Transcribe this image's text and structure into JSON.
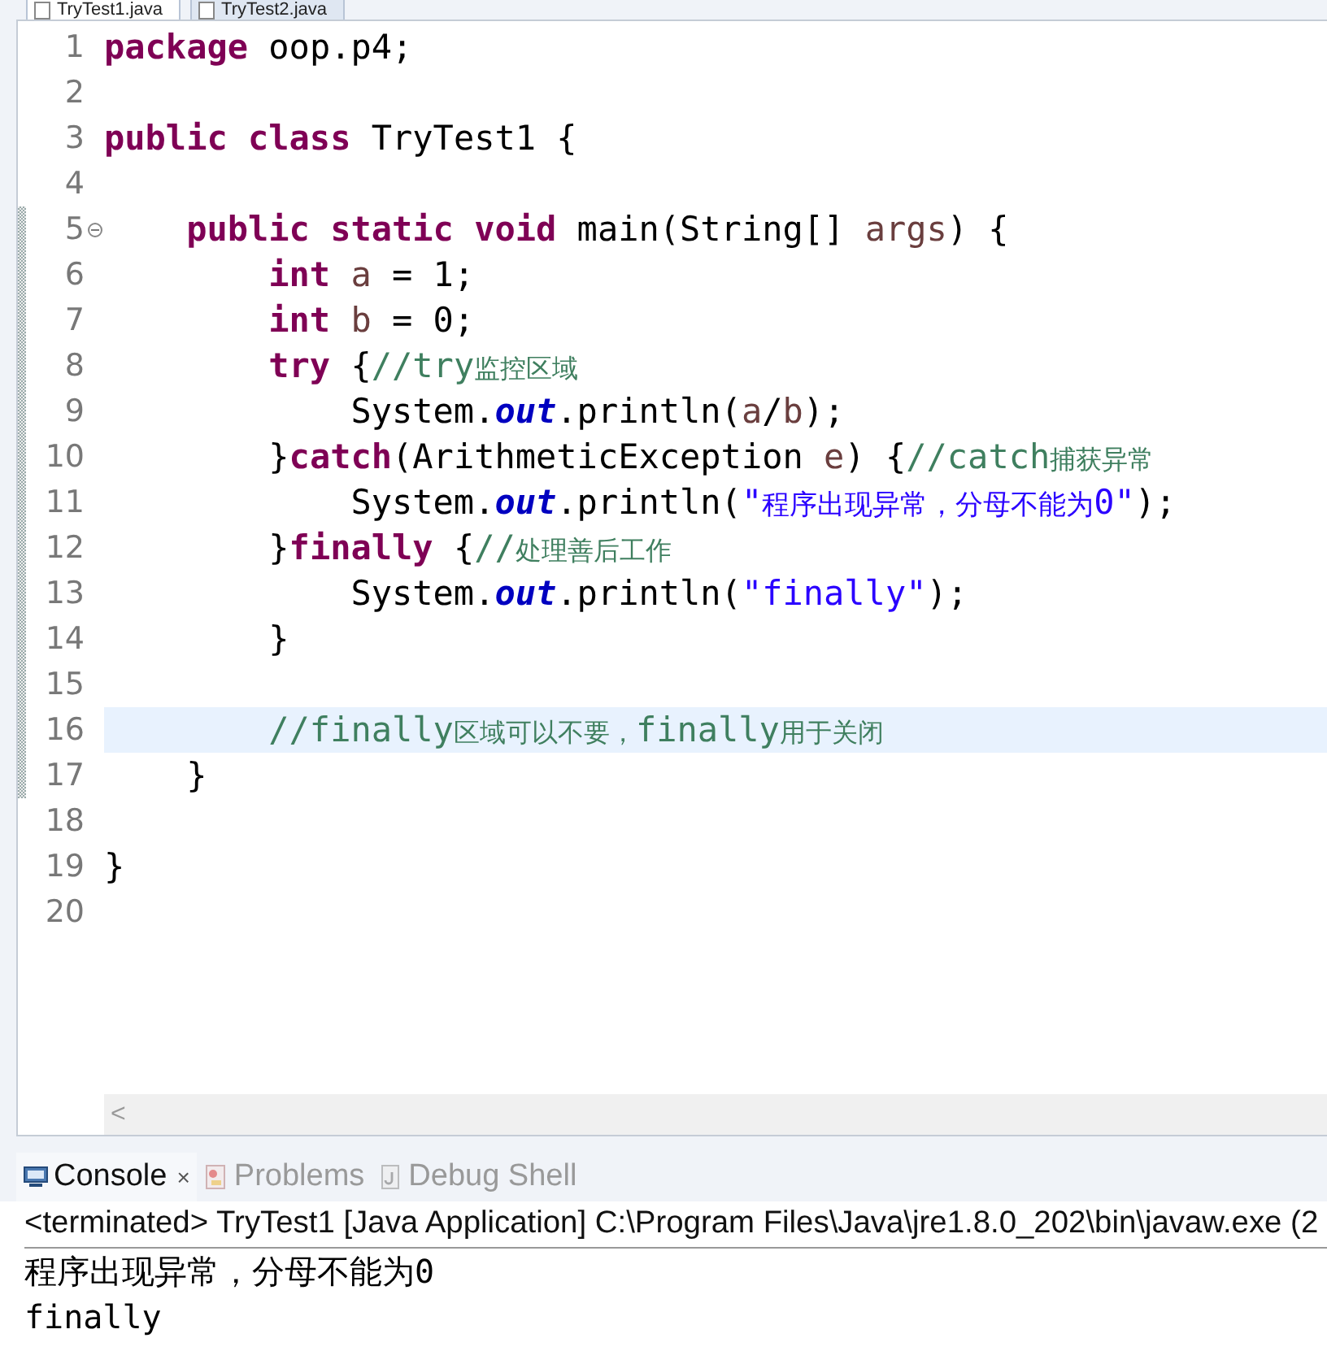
{
  "editor_tabs": [
    {
      "label": "TryTest1.java",
      "selected": true
    },
    {
      "label": "TryTest2.java",
      "selected": false
    }
  ],
  "code_lines": [
    {
      "number": "1",
      "fold": false,
      "changed": false,
      "current": false,
      "tokens": [
        {
          "kind": "keyword",
          "text": "package "
        },
        {
          "kind": "plain",
          "text": "oop.p4;"
        }
      ]
    },
    {
      "number": "2",
      "fold": false,
      "changed": false,
      "current": false
    },
    {
      "number": "3",
      "fold": false,
      "changed": false,
      "current": false,
      "tokens": [
        {
          "kind": "keyword",
          "text": "public class "
        },
        {
          "kind": "plain",
          "text": "TryTest1 {"
        }
      ]
    },
    {
      "number": "4",
      "fold": false,
      "changed": false,
      "current": false
    },
    {
      "number": "5",
      "fold": true,
      "changed": true,
      "current": false,
      "tokens": [
        {
          "kind": "keyword",
          "text": "    public static void "
        },
        {
          "kind": "plain",
          "text": "main(String[] "
        },
        {
          "kind": "local",
          "text": "args"
        },
        {
          "kind": "plain",
          "text": ") {"
        }
      ]
    },
    {
      "number": "6",
      "fold": false,
      "changed": true,
      "current": false,
      "tokens": [
        {
          "kind": "keyword",
          "text": "        int "
        },
        {
          "kind": "local",
          "text": "a"
        },
        {
          "kind": "plain",
          "text": " = 1;"
        }
      ]
    },
    {
      "number": "7",
      "fold": false,
      "changed": true,
      "current": false,
      "tokens": [
        {
          "kind": "keyword",
          "text": "        int "
        },
        {
          "kind": "local",
          "text": "b"
        },
        {
          "kind": "plain",
          "text": " = 0;"
        }
      ]
    },
    {
      "number": "8",
      "fold": false,
      "changed": true,
      "current": false,
      "tokens": [
        {
          "kind": "keyword",
          "text": "        try"
        },
        {
          "kind": "plain",
          "text": " {"
        },
        {
          "kind": "comment",
          "text": "//try"
        },
        {
          "kind": "comment_cjk",
          "text": "监控区域"
        }
      ]
    },
    {
      "number": "9",
      "fold": false,
      "changed": true,
      "current": false,
      "tokens": [
        {
          "kind": "plain",
          "text": "            System."
        },
        {
          "kind": "field",
          "text": "out"
        },
        {
          "kind": "plain",
          "text": ".println("
        },
        {
          "kind": "local",
          "text": "a"
        },
        {
          "kind": "plain",
          "text": "/"
        },
        {
          "kind": "local",
          "text": "b"
        },
        {
          "kind": "plain",
          "text": ");"
        }
      ]
    },
    {
      "number": "10",
      "fold": false,
      "changed": true,
      "current": false,
      "tokens": [
        {
          "kind": "plain",
          "text": "        }"
        },
        {
          "kind": "keyword",
          "text": "catch"
        },
        {
          "kind": "plain",
          "text": "(ArithmeticException "
        },
        {
          "kind": "local",
          "text": "e"
        },
        {
          "kind": "plain",
          "text": ") {"
        },
        {
          "kind": "comment",
          "text": "//catch"
        },
        {
          "kind": "comment_cjk",
          "text": "捕获异常"
        }
      ]
    },
    {
      "number": "11",
      "fold": false,
      "changed": true,
      "current": false,
      "tokens": [
        {
          "kind": "plain",
          "text": "            System."
        },
        {
          "kind": "field",
          "text": "out"
        },
        {
          "kind": "plain",
          "text": ".println("
        },
        {
          "kind": "string",
          "text": "\""
        },
        {
          "kind": "string_cjk",
          "text": "程序出现异常，分母不能为"
        },
        {
          "kind": "string",
          "text": "0\""
        },
        {
          "kind": "plain",
          "text": ");"
        }
      ]
    },
    {
      "number": "12",
      "fold": false,
      "changed": true,
      "current": false,
      "tokens": [
        {
          "kind": "plain",
          "text": "        }"
        },
        {
          "kind": "keyword",
          "text": "finally"
        },
        {
          "kind": "plain",
          "text": " {"
        },
        {
          "kind": "comment",
          "text": "//"
        },
        {
          "kind": "comment_cjk",
          "text": "处理善后工作"
        }
      ]
    },
    {
      "number": "13",
      "fold": false,
      "changed": true,
      "current": false,
      "tokens": [
        {
          "kind": "plain",
          "text": "            System."
        },
        {
          "kind": "field",
          "text": "out"
        },
        {
          "kind": "plain",
          "text": ".println("
        },
        {
          "kind": "string",
          "text": "\"finally\""
        },
        {
          "kind": "plain",
          "text": ");"
        }
      ]
    },
    {
      "number": "14",
      "fold": false,
      "changed": true,
      "current": false,
      "tokens": [
        {
          "kind": "plain",
          "text": "        }"
        }
      ]
    },
    {
      "number": "15",
      "fold": false,
      "changed": true,
      "current": false
    },
    {
      "number": "16",
      "fold": false,
      "changed": true,
      "current": true,
      "tokens": [
        {
          "kind": "comment",
          "text": "        //finally"
        },
        {
          "kind": "comment_cjk",
          "text": "区域可以不要，"
        },
        {
          "kind": "comment",
          "text": "finally"
        },
        {
          "kind": "comment_cjk",
          "text": "用于关闭"
        }
      ]
    },
    {
      "number": "17",
      "fold": false,
      "changed": true,
      "current": false,
      "tokens": [
        {
          "kind": "plain",
          "text": "    }"
        }
      ]
    },
    {
      "number": "18",
      "fold": false,
      "changed": false,
      "current": false
    },
    {
      "number": "19",
      "fold": false,
      "changed": false,
      "current": false,
      "tokens": [
        {
          "kind": "plain",
          "text": "}"
        }
      ]
    },
    {
      "number": "20",
      "fold": false,
      "changed": false,
      "current": false
    }
  ],
  "scrollbar": {
    "arrow": "<"
  },
  "console_tabs": [
    {
      "label": "Console",
      "kind": "console",
      "selected": true,
      "close": "×"
    },
    {
      "label": "Problems",
      "kind": "problems",
      "selected": false
    },
    {
      "label": "Debug Shell",
      "kind": "debug",
      "selected": false
    }
  ],
  "console": {
    "header": "<terminated> TryTest1 [Java Application] C:\\Program Files\\Java\\jre1.8.0_202\\bin\\javaw.exe (2",
    "output": [
      "程序出现异常，分母不能为0",
      "finally"
    ]
  }
}
